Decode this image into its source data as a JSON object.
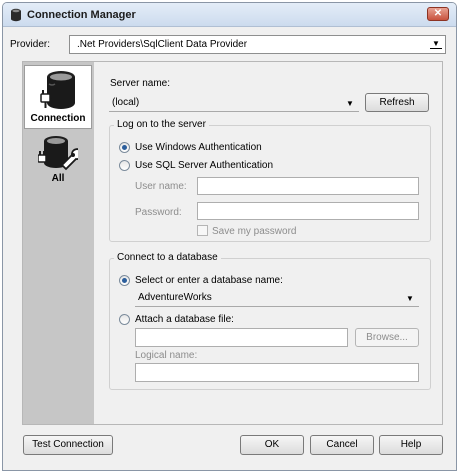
{
  "window": {
    "title": "Connection Manager",
    "close_glyph": "✕"
  },
  "provider": {
    "label": "Provider:",
    "value": ".Net Providers\\SqlClient Data Provider"
  },
  "nav": {
    "items": [
      {
        "label": "Connection",
        "icon": "database-plug-icon",
        "selected": true
      },
      {
        "label": "All",
        "icon": "database-wrench-icon",
        "selected": false
      }
    ]
  },
  "server": {
    "label": "Server name:",
    "value": "(local)",
    "refresh_label": "Refresh"
  },
  "logon": {
    "group_title": "Log on to the server",
    "windows_auth_label": "Use Windows Authentication",
    "sql_auth_label": "Use SQL Server Authentication",
    "selected": "windows",
    "username_label": "User name:",
    "password_label": "Password:",
    "save_password_label": "Save my password"
  },
  "database": {
    "group_title": "Connect to a database",
    "select_label": "Select or enter a database name:",
    "database_value": "AdventureWorks",
    "attach_label": "Attach a database file:",
    "browse_label": "Browse...",
    "logical_name_label": "Logical name:",
    "selected": "select"
  },
  "buttons": {
    "test_connection": "Test Connection",
    "ok": "OK",
    "cancel": "Cancel",
    "help": "Help"
  }
}
